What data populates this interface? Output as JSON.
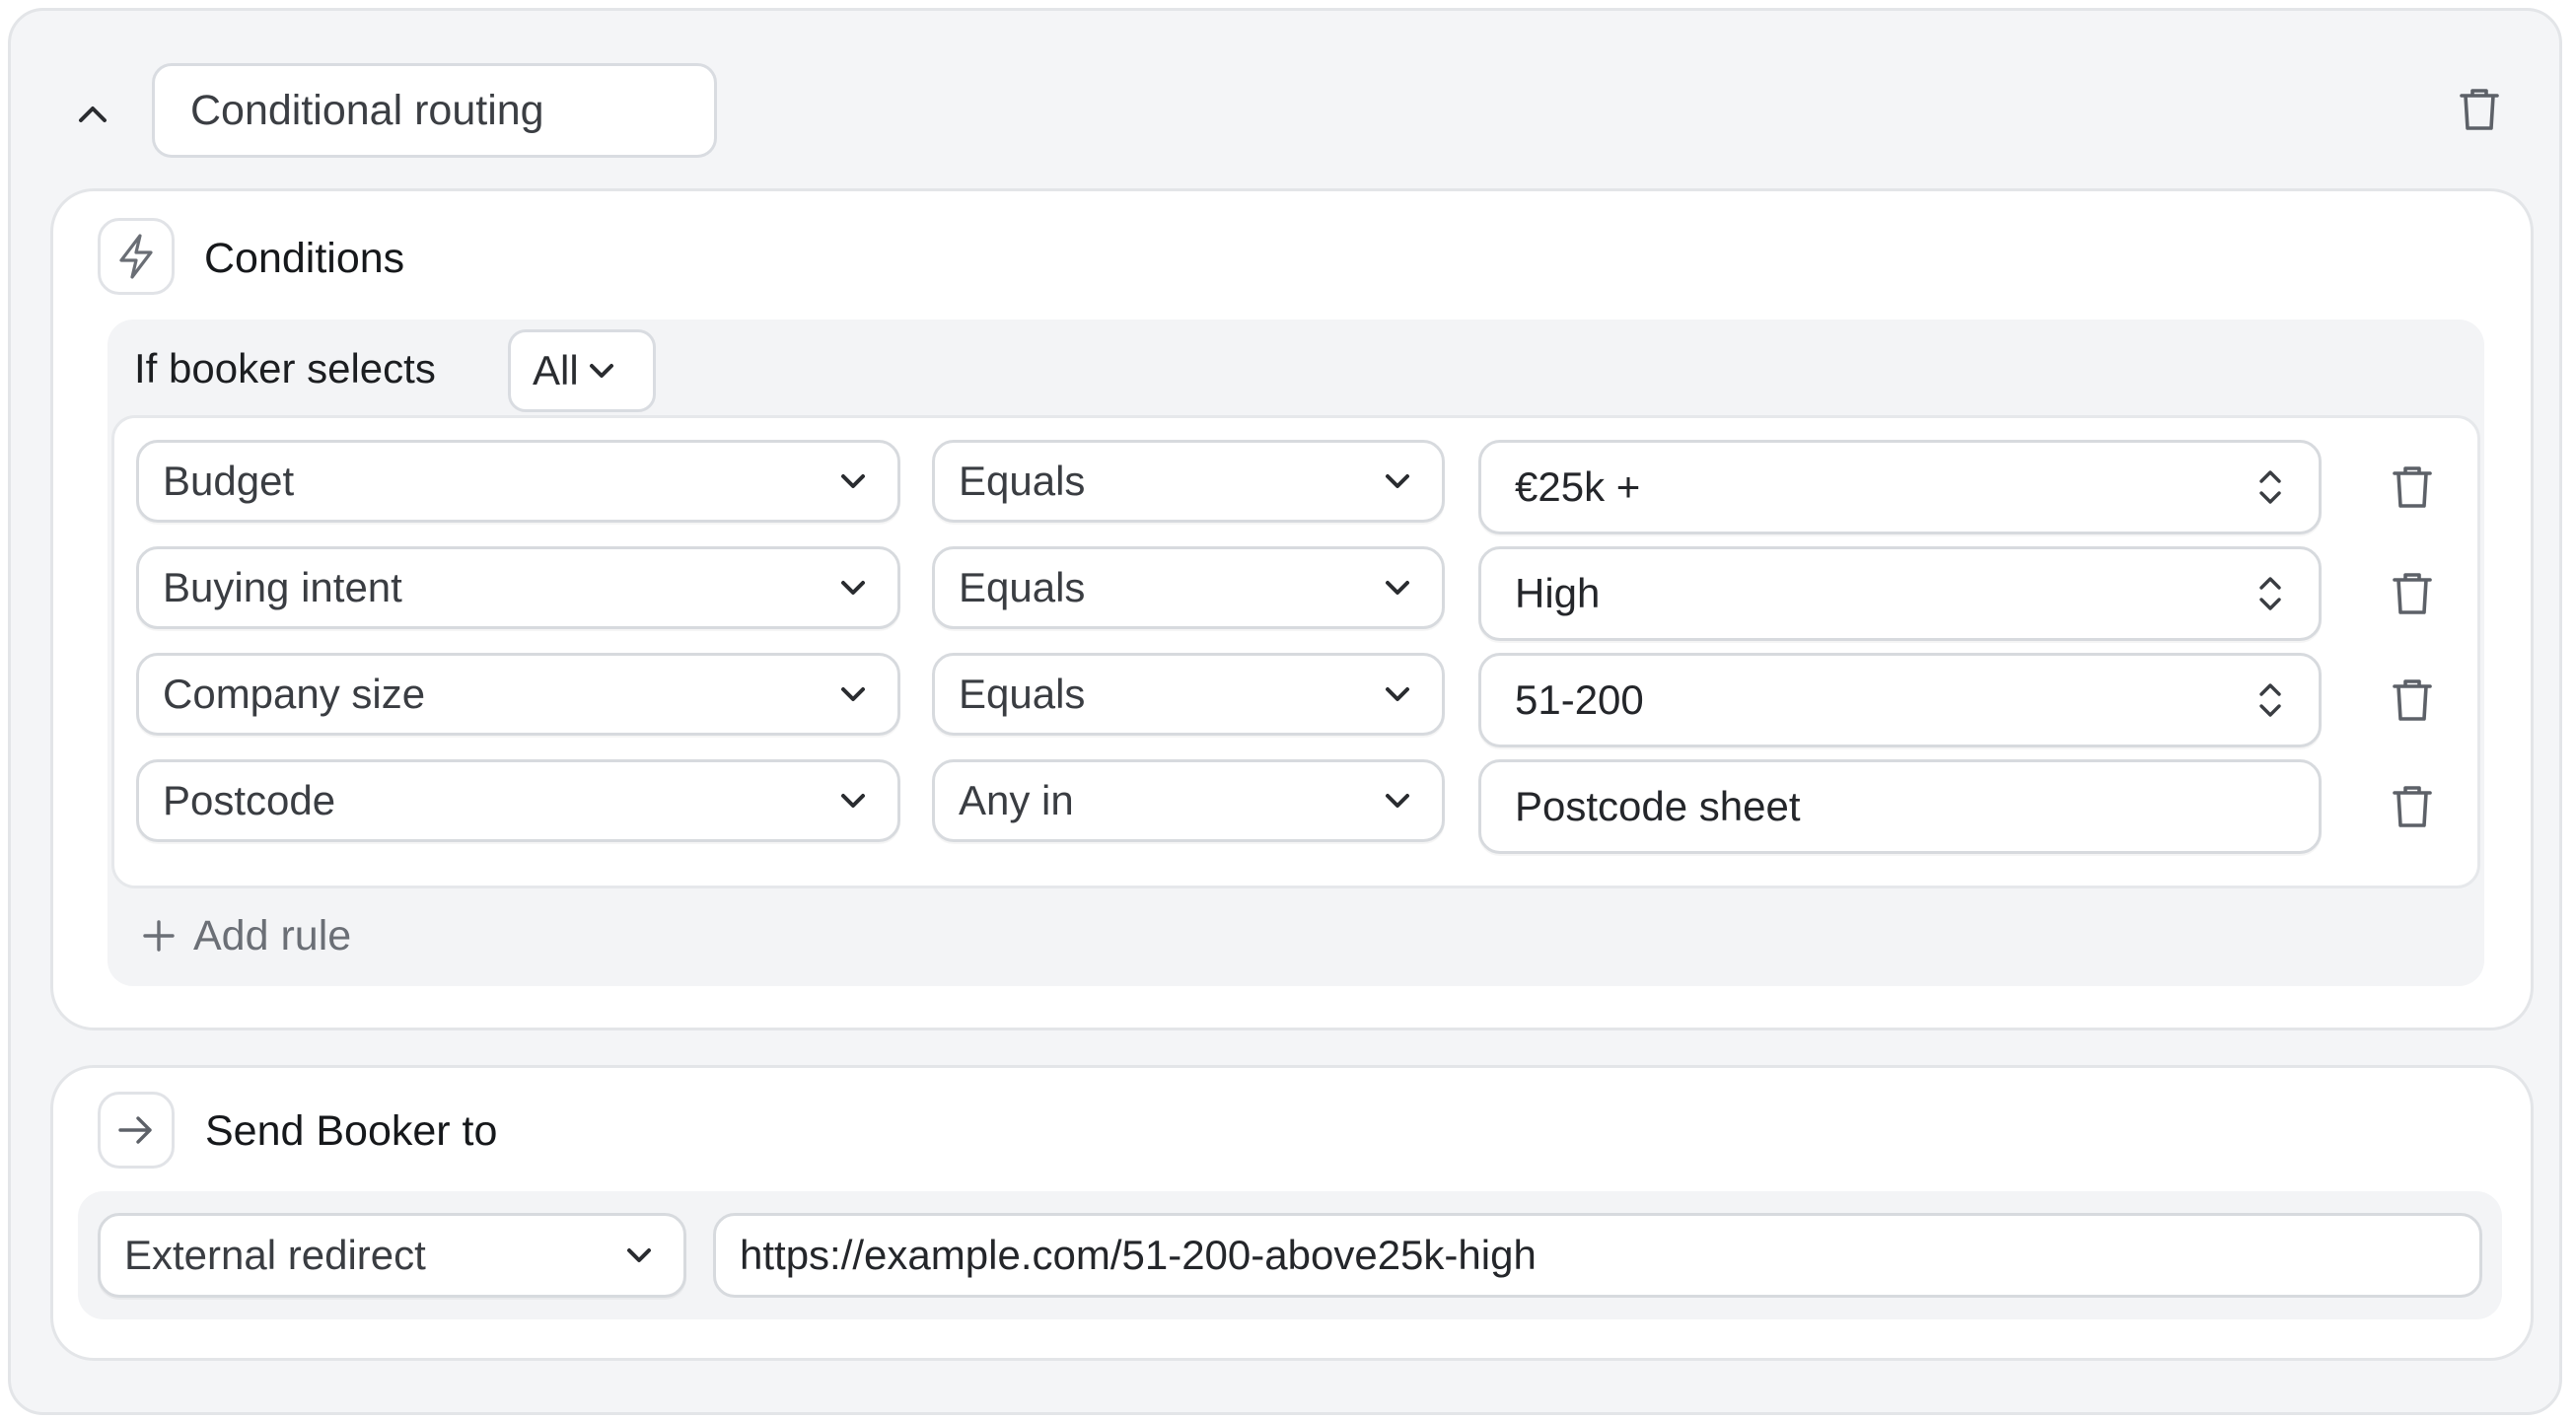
{
  "header": {
    "rule_name": "Conditional routing"
  },
  "conditions": {
    "title": "Conditions",
    "if_label": "If booker selects",
    "match_mode": "All",
    "rules": [
      {
        "field": "Budget",
        "operator": "Equals",
        "value": "€25k +",
        "value_type": "stepper"
      },
      {
        "field": "Buying intent",
        "operator": "Equals",
        "value": "High",
        "value_type": "stepper"
      },
      {
        "field": "Company size",
        "operator": "Equals",
        "value": "51-200",
        "value_type": "stepper"
      },
      {
        "field": "Postcode",
        "operator": "Any in",
        "value": "Postcode sheet",
        "value_type": "text"
      }
    ],
    "add_rule_label": "Add rule"
  },
  "destination": {
    "title": "Send Booker to",
    "type": "External redirect",
    "url": "https://example.com/51-200-above25k-high"
  }
}
